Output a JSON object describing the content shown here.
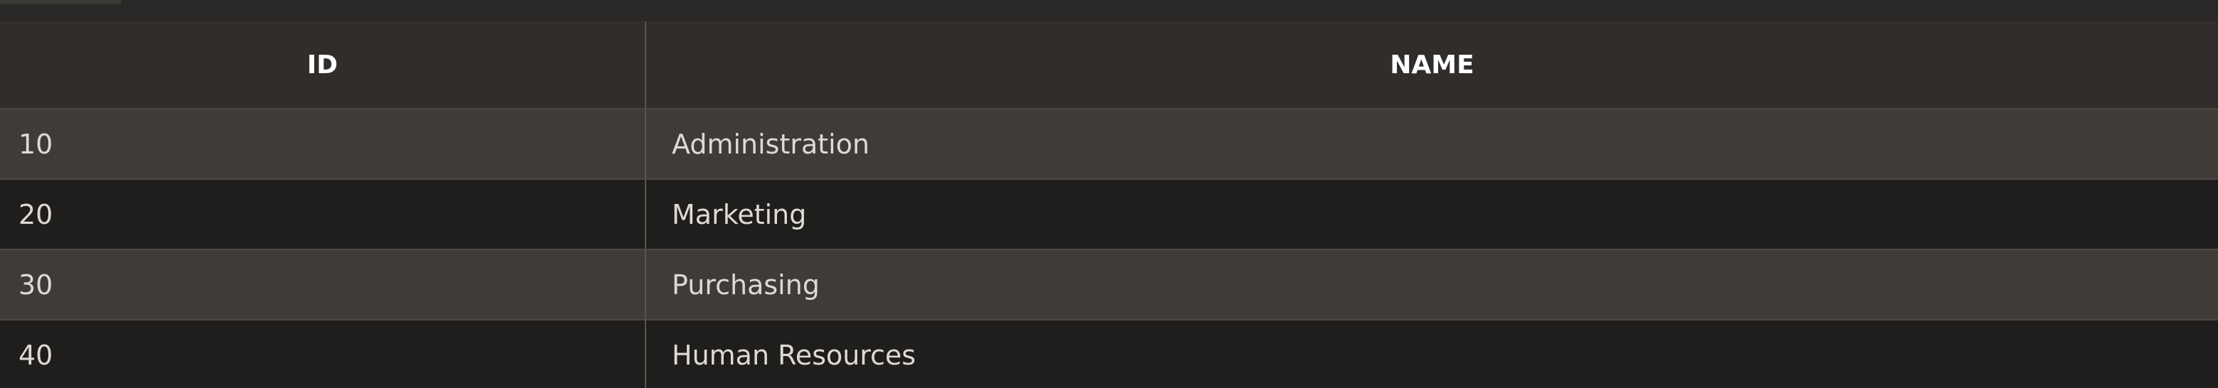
{
  "table": {
    "columns": [
      {
        "label": "ID"
      },
      {
        "label": "NAME"
      }
    ],
    "rows": [
      {
        "id": "10",
        "name": "Administration"
      },
      {
        "id": "20",
        "name": "Marketing"
      },
      {
        "id": "30",
        "name": "Purchasing"
      },
      {
        "id": "40",
        "name": "Human Resources"
      }
    ]
  },
  "colors": {
    "header_bg": "#312d2a",
    "row_alt_bg": "#3f3b37",
    "row_bg": "#1f1e1c",
    "header_text": "#ffffff",
    "cell_text": "#dddad6"
  }
}
